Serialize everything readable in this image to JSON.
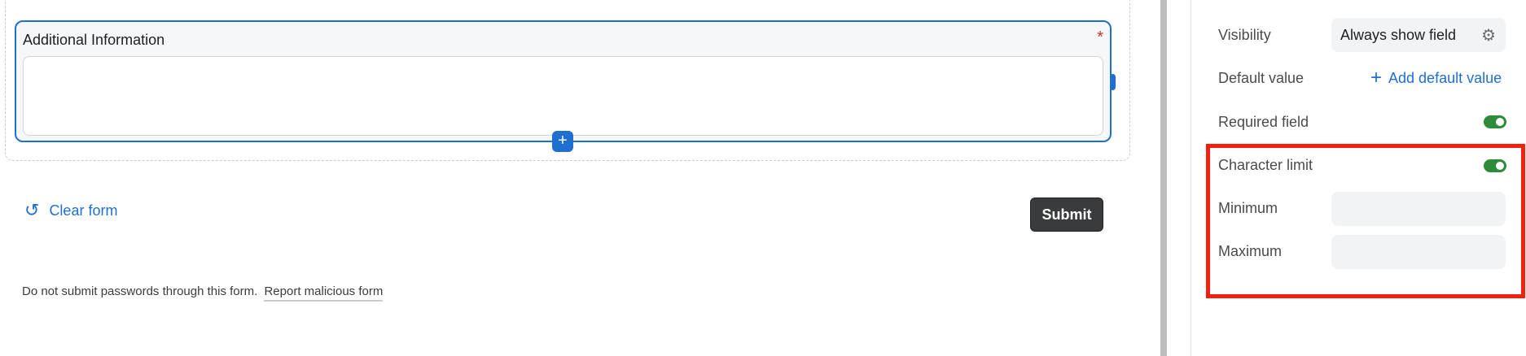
{
  "form": {
    "field_label": "Additional Information",
    "required_marker": "*",
    "add_button_glyph": "+",
    "clear_label": "Clear form",
    "submit_label": "Submit",
    "footer_text": "Do not submit passwords through this form.",
    "report_link": "Report malicious form"
  },
  "settings": {
    "visibility_label": "Visibility",
    "visibility_value": "Always show field",
    "default_label": "Default value",
    "add_default_label": "Add default value",
    "required_label": "Required field",
    "required_on": true,
    "char_limit_label": "Character limit",
    "char_limit_on": true,
    "minimum_label": "Minimum",
    "minimum_value": "",
    "maximum_label": "Maximum",
    "maximum_value": ""
  },
  "colors": {
    "accent": "#1f6fd1",
    "toggle_on": "#2e8b3a",
    "highlight": "#f2200c",
    "required": "#c92f2f"
  },
  "icons": {
    "undo": "undo-icon",
    "gear": "gear-icon",
    "plus": "plus-icon",
    "chevron": "chevron-down-icon"
  }
}
